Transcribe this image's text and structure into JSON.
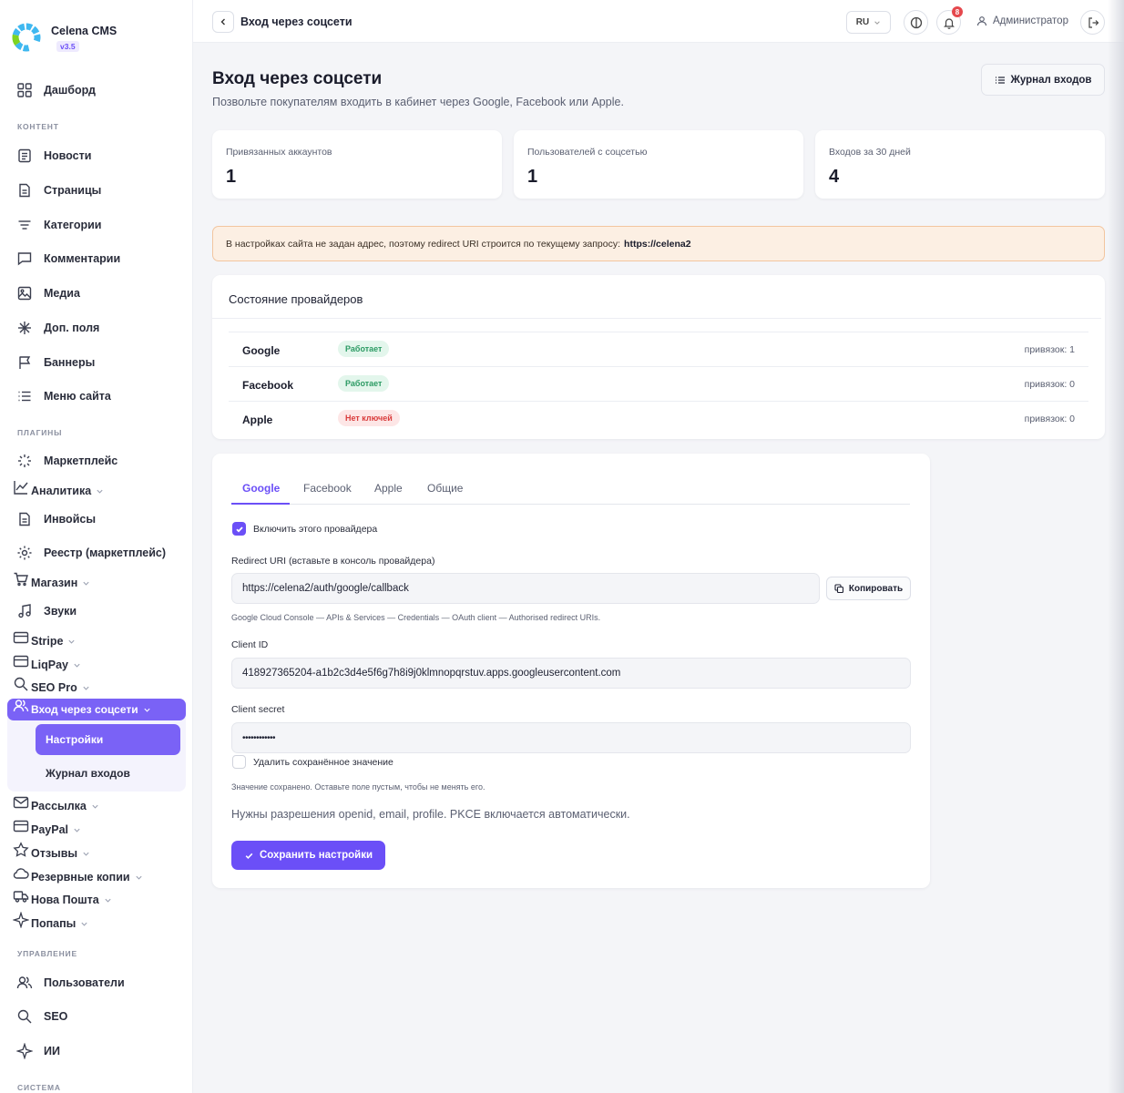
{
  "brand": {
    "name": "Celena CMS",
    "version": "v3.5"
  },
  "sidebar": {
    "sections": {
      "content": "КОНТЕНТ",
      "plugins": "ПЛАГИНЫ",
      "management": "УПРАВЛЕНИЕ",
      "system": "СИСТЕМА"
    },
    "dashboard": "Дашборд",
    "content_items": [
      "Новости",
      "Страницы",
      "Категории",
      "Комментарии",
      "Медиа",
      "Доп. поля",
      "Баннеры",
      "Меню сайта"
    ],
    "plugin_items": [
      "Маркетплейс",
      "Аналитика",
      "Инвойсы",
      "Реестр (маркетплейс)",
      "Магазин",
      "Звуки",
      "Stripe",
      "LiqPay",
      "SEO Pro",
      "Вход через соцсети",
      "Рассылка",
      "PayPal",
      "Отзывы",
      "Резервные копии",
      "Нова Пошта",
      "Попапы"
    ],
    "submenu": [
      "Настройки",
      "Журнал входов"
    ],
    "management_items": [
      "Пользователи",
      "SEO",
      "ИИ"
    ]
  },
  "topbar": {
    "breadcrumb": "Вход через соцсети",
    "language": "RU",
    "notifications": "8",
    "user": "Администратор"
  },
  "header": {
    "title": "Вход через соцсети",
    "subtitle": "Позвольте покупателям входить в кабинет через Google, Facebook или Apple.",
    "log_button": "Журнал входов"
  },
  "stats": [
    {
      "label": "Привязанных аккаунтов",
      "value": "1"
    },
    {
      "label": "Пользователей с соцсетью",
      "value": "1"
    },
    {
      "label": "Входов за 30 дней",
      "value": "4"
    }
  ],
  "alert": {
    "text": "В настройках сайта не задан адрес, поэтому redirect URI строится по текущему запросу:",
    "url": "https://celena2"
  },
  "providers": {
    "title": "Состояние провайдеров",
    "rows": [
      {
        "name": "Google",
        "status": "Работает",
        "count": "привязок: 1"
      },
      {
        "name": "Facebook",
        "status": "Работает",
        "count": "привязок: 0"
      },
      {
        "name": "Apple",
        "status": "Нет ключей",
        "count": "привязок: 0"
      }
    ]
  },
  "form": {
    "tabs": [
      "Google",
      "Facebook",
      "Apple",
      "Общие"
    ],
    "enable_label": "Включить этого провайдера",
    "redirect_label": "Redirect URI (вставьте в консоль провайдера)",
    "redirect_value": "https://celena2/auth/google/callback",
    "copy_button": "Копировать",
    "redirect_hint": "Google Cloud Console — APIs & Services — Credentials — OAuth client — Authorised redirect URIs.",
    "client_id_label": "Client ID",
    "client_id_value": "418927365204-a1b2c3d4e5f6g7h8i9j0klmnopqrstuv.apps.googleusercontent.com",
    "client_secret_label": "Client secret",
    "client_secret_value": "••••••••••••",
    "delete_label": "Удалить сохранённое значение",
    "secret_hint": "Значение сохранено. Оставьте поле пустым, чтобы не менять его.",
    "note": "Нужны разрешения openid, email, profile. PKCE включается автоматически.",
    "save_button": "Сохранить настройки"
  },
  "colors": {
    "accent": "#6b4ff7",
    "success": "#2c9b64",
    "danger": "#d93c3c",
    "warning_bg": "#fcefe3"
  }
}
